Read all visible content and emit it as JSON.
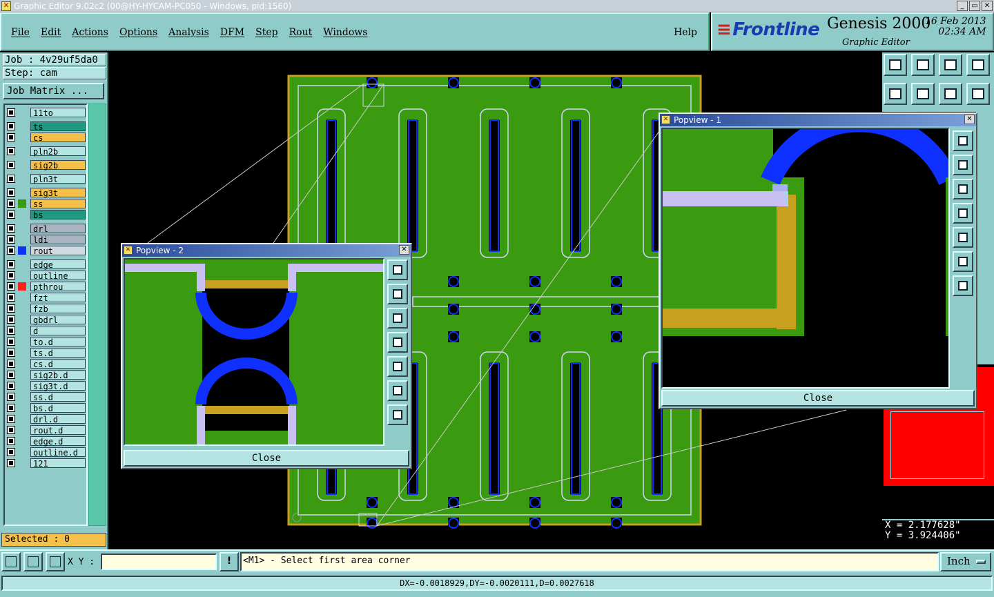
{
  "window": {
    "title": "Graphic Editor 9.02c2 (00@HY-HYCAM-PC050 - Windows, pid:1560)",
    "buttons": [
      "_",
      "▭",
      "✕"
    ]
  },
  "menu": {
    "items": [
      "File",
      "Edit",
      "Actions",
      "Options",
      "Analysis",
      "DFM",
      "Step",
      "Rout",
      "Windows"
    ],
    "help": "Help"
  },
  "brand": {
    "logo": "Frontline",
    "product": "Genesis 2000",
    "subtitle": "Graphic Editor",
    "date": "16 Feb 2013",
    "time": "02:34 AM"
  },
  "job": {
    "job_label": "Job : 4v29uf5da0",
    "step_label": "Step: cam",
    "matrix_button": "Job Matrix ..."
  },
  "layers": [
    {
      "name": "11to",
      "swatch": "",
      "highlight": "#b4e4e2"
    },
    {
      "name": "ts",
      "swatch": "",
      "highlight": "#1f9a80"
    },
    {
      "name": "cs",
      "swatch": "",
      "highlight": "#f5c04a"
    },
    {
      "name": "pln2b",
      "swatch": "",
      "highlight": "#b4e4e2"
    },
    {
      "name": "sig2b",
      "swatch": "",
      "highlight": "#f5c04a"
    },
    {
      "name": "pln3t",
      "swatch": "",
      "highlight": "#b4e4e2"
    },
    {
      "name": "sig3t",
      "swatch": "",
      "highlight": "#f5c04a"
    },
    {
      "name": "ss",
      "swatch": "#3a9a10",
      "highlight": "#f5c04a"
    },
    {
      "name": "bs",
      "swatch": "",
      "highlight": "#1f9a80"
    },
    {
      "name": "drl",
      "swatch": "",
      "highlight": "#aab4c0"
    },
    {
      "name": "ldi",
      "swatch": "",
      "highlight": "#aab4c0"
    },
    {
      "name": "rout",
      "swatch": "#1030ff",
      "highlight": "#d0d8e0"
    },
    {
      "name": "edge",
      "swatch": "",
      "highlight": "#b4e4e2"
    },
    {
      "name": "outline",
      "swatch": "",
      "highlight": "#b4e4e2"
    },
    {
      "name": "pthrou",
      "swatch": "#ff2020",
      "highlight": "#b4e4e2"
    },
    {
      "name": "fzt",
      "swatch": "",
      "highlight": "#b4e4e2"
    },
    {
      "name": "fzb",
      "swatch": "",
      "highlight": "#b4e4e2"
    },
    {
      "name": "gbdrl",
      "swatch": "",
      "highlight": "#b4e4e2"
    },
    {
      "name": "d",
      "swatch": "",
      "highlight": "#b4e4e2"
    },
    {
      "name": "to.d",
      "swatch": "",
      "highlight": "#b4e4e2"
    },
    {
      "name": "ts.d",
      "swatch": "",
      "highlight": "#b4e4e2"
    },
    {
      "name": "cs.d",
      "swatch": "",
      "highlight": "#b4e4e2"
    },
    {
      "name": "sig2b.d",
      "swatch": "",
      "highlight": "#b4e4e2"
    },
    {
      "name": "sig3t.d",
      "swatch": "",
      "highlight": "#b4e4e2"
    },
    {
      "name": "ss.d",
      "swatch": "",
      "highlight": "#b4e4e2"
    },
    {
      "name": "bs.d",
      "swatch": "",
      "highlight": "#b4e4e2"
    },
    {
      "name": "drl.d",
      "swatch": "",
      "highlight": "#b4e4e2"
    },
    {
      "name": "rout.d",
      "swatch": "",
      "highlight": "#b4e4e2"
    },
    {
      "name": "edge.d",
      "swatch": "",
      "highlight": "#b4e4e2"
    },
    {
      "name": "outline.d",
      "swatch": "",
      "highlight": "#b4e4e2"
    },
    {
      "name": "121",
      "swatch": "",
      "highlight": "#b4e4e2"
    }
  ],
  "selected_label": "Selected : 0",
  "popview1": {
    "title": "Popview - 1",
    "close_button": "Close"
  },
  "popview2": {
    "title": "Popview - 2",
    "close_button": "Close"
  },
  "coords": {
    "x": "X = 2.177628\"",
    "y": "Y = 3.924406\""
  },
  "bottom": {
    "xy_label": "X Y :",
    "xy_value": "",
    "warn_button": "!",
    "prompt": "<M1> - Select first area corner",
    "unit": "Inch"
  },
  "status": "DX=-0.0018929,DY=-0.0020111,D=0.0027618",
  "colors": {
    "panel": "#8fcbc9",
    "board_green": "#3a9a10",
    "copper": "#c8a020",
    "rout_blue": "#1030ff",
    "outline": "#d0d8f0",
    "highlight_red": "#ff0000"
  }
}
